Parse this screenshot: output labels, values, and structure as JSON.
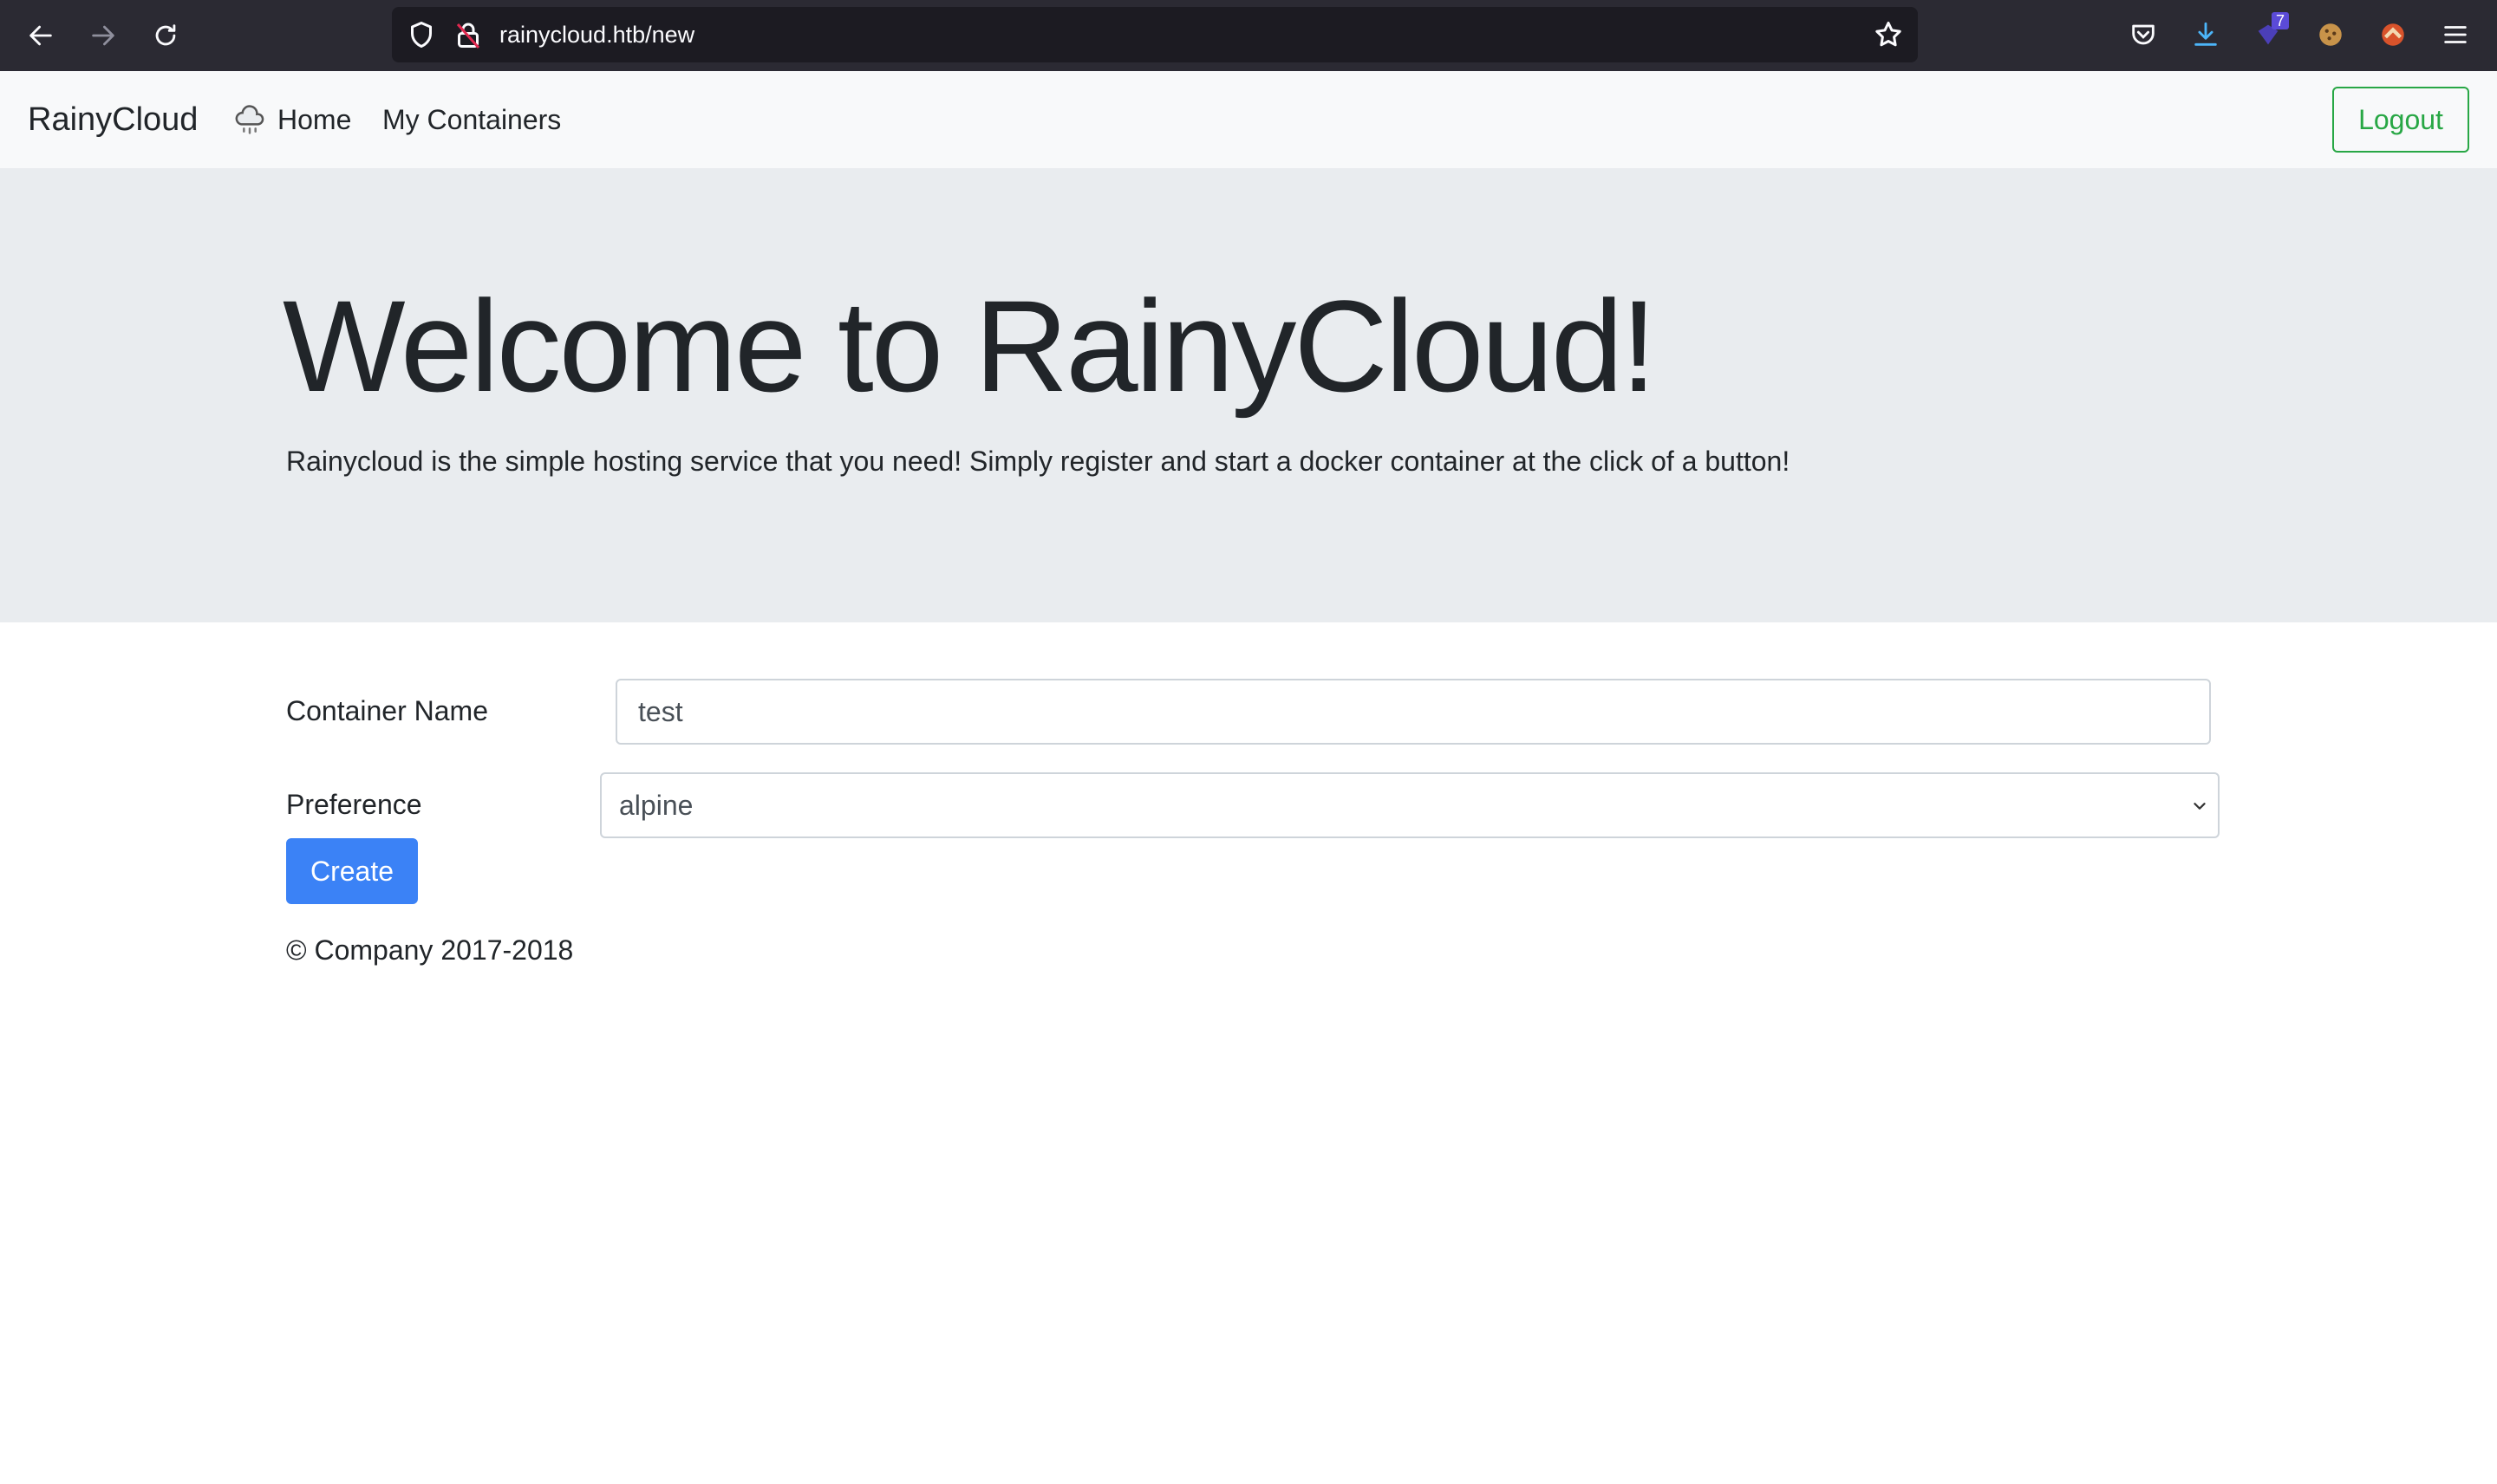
{
  "browser": {
    "url": "rainycloud.htb/new",
    "extension_badge": "7"
  },
  "navbar": {
    "brand": "RainyCloud",
    "links": [
      {
        "label": "Home"
      },
      {
        "label": "My Containers"
      }
    ],
    "logout_label": "Logout"
  },
  "hero": {
    "title": "Welcome to RainyCloud!",
    "lead": "Rainycloud is the simple hosting service that you need! Simply register and start a docker container at the click of a button!"
  },
  "form": {
    "name_label": "Container Name",
    "name_value": "test",
    "preference_label": "Preference",
    "preference_value": "alpine",
    "submit_label": "Create"
  },
  "footer": {
    "text": "© Company 2017-2018"
  },
  "colors": {
    "primary": "#3b82f6",
    "success": "#28a745",
    "jumbotron_bg": "#e9ecef",
    "browser_chrome": "#2b2a33"
  }
}
